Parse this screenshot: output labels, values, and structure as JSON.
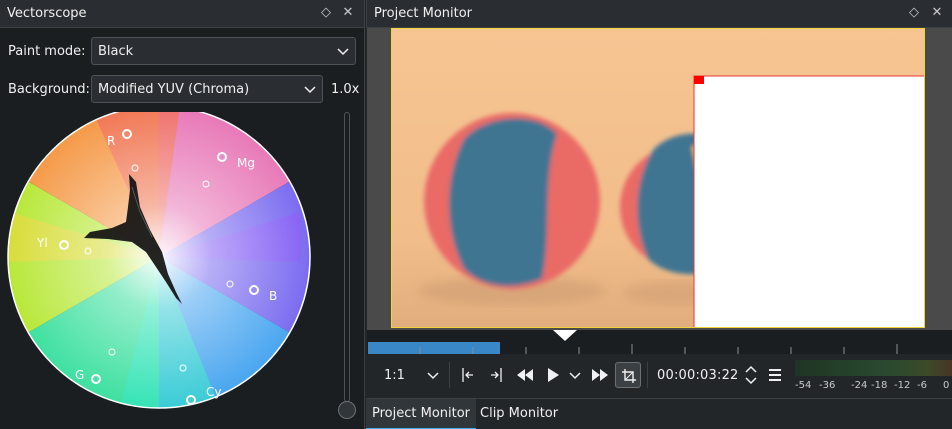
{
  "vectorscope": {
    "title": "Vectorscope",
    "paint_mode_label": "Paint mode:",
    "paint_mode_value": "Black",
    "background_label": "Background:",
    "background_value": "Modified YUV (Chroma)",
    "zoom_value": "1.0x",
    "markers": {
      "r": "R",
      "mg": "Mg",
      "b": "B",
      "cy": "Cy",
      "g": "G",
      "yl": "Yl"
    },
    "zoom_level": 0.0
  },
  "project_monitor": {
    "title": "Project Monitor",
    "zoom_select": "1:1",
    "timecode": "00:00:03:22",
    "meter_scale": [
      "-54",
      "-36",
      "-24",
      "-18",
      "-12",
      "-6",
      "0"
    ],
    "tabs": [
      {
        "label": "Project Monitor",
        "active": true
      },
      {
        "label": "Clip Monitor",
        "active": false
      }
    ]
  },
  "colors": {
    "accent": "#3daee9",
    "zone": "#3a87c7",
    "frame_border": "#f0d23a",
    "overlay_border": "#e53935"
  },
  "icons": {
    "float": "diamond-icon",
    "close": "close-icon",
    "set_in": "set-zone-in-icon",
    "set_out": "set-zone-out-icon",
    "rewind": "rewind-icon",
    "play": "play-icon",
    "play_options": "chevron-down-icon",
    "forward": "fast-forward-icon",
    "crop": "crop-icon",
    "timecode_spin": "up-down-arrows-icon",
    "menu": "hamburger-menu-icon"
  }
}
